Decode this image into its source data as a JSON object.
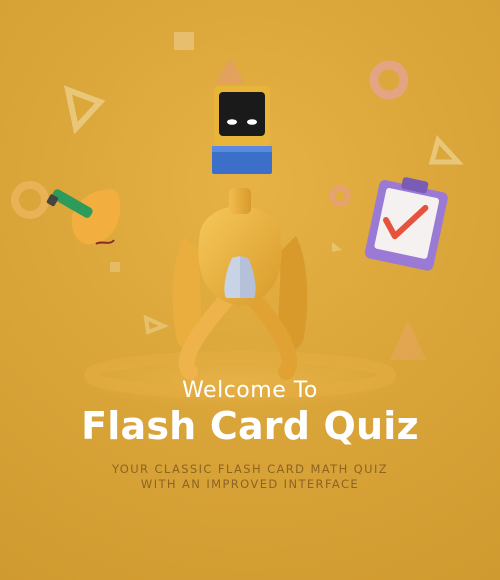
{
  "welcome": "Welcome To",
  "title": "Flash Card Quiz",
  "subtitle": {
    "line1": "YOUR CLASSIC FLASH CARD MATH QUIZ",
    "line2": "WITH AN IMPROVED INTERFACE"
  },
  "colors": {
    "background": "#dca73b",
    "title_text": "#ffffff",
    "subtitle_text": "#8d6422",
    "robot_screen": "#1a1a1a",
    "robot_frame": "#e8b53a",
    "robot_base": "#3b6fc9",
    "clipboard": "#9b7ad6",
    "check_mark": "#e5533d"
  },
  "icons": [
    "robot-icon",
    "pencil-hand-icon",
    "clipboard-check-icon",
    "triangle-icon",
    "ring-icon",
    "square-icon"
  ]
}
